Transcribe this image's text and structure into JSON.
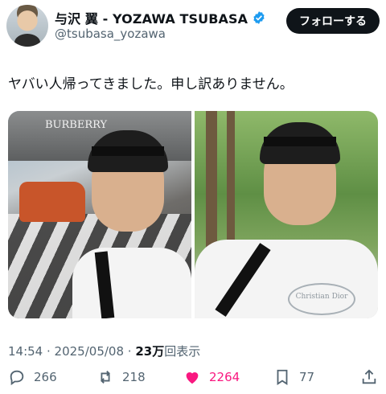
{
  "user": {
    "display_name": "与沢 翼 - YOZAWA TSUBASA",
    "handle": "@tsubasa_yozawa",
    "follow_label": "フォローする",
    "verified_color": "#1d9bf0"
  },
  "tweet": {
    "text": "ヤバい人帰ってきました。申し訳ありません。",
    "time": "14:54",
    "date": "2025/05/08",
    "views_count": "23万",
    "views_label": "回表示",
    "separator": " · "
  },
  "media": {
    "left_sign": "BURBERRY",
    "right_shirt_text": "Christian Dior"
  },
  "actions": {
    "replies": "266",
    "reposts": "218",
    "likes": "2264",
    "bookmarks": "77",
    "like_color": "#f91880"
  }
}
